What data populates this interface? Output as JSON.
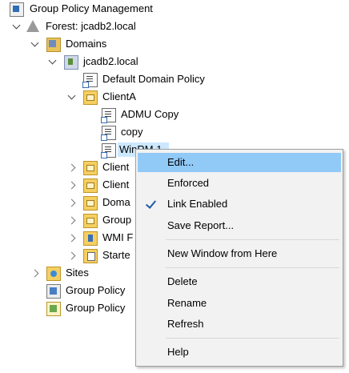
{
  "tree": {
    "root": "Group Policy Management",
    "forest": "Forest: jcadb2.local",
    "domains": "Domains",
    "domain": "jcadb2.local",
    "default_policy": "Default Domain Policy",
    "client_a": "ClientA",
    "admu_copy": "ADMU Copy",
    "copy": "copy",
    "winrm": "WinRM 1",
    "client_b_partial": "Client",
    "client_c_partial": "Client",
    "domain_controllers_partial": "Doma",
    "group_policy_objects_partial": "Group",
    "wmi_filters_partial": "WMI F",
    "starter_gpos_partial": "Starte",
    "sites": "Sites",
    "modeling_partial": "Group Policy",
    "results_partial": "Group Policy"
  },
  "context_menu": {
    "items": [
      "Edit...",
      "Enforced",
      "Link Enabled",
      "Save Report...",
      "New Window from Here",
      "Delete",
      "Rename",
      "Refresh",
      "Help"
    ],
    "highlighted": "Edit...",
    "checked": "Link Enabled"
  },
  "colors": {
    "menu_highlight": "#91c9f7",
    "selection": "#cce8ff",
    "checkmark": "#1e5ca8"
  }
}
